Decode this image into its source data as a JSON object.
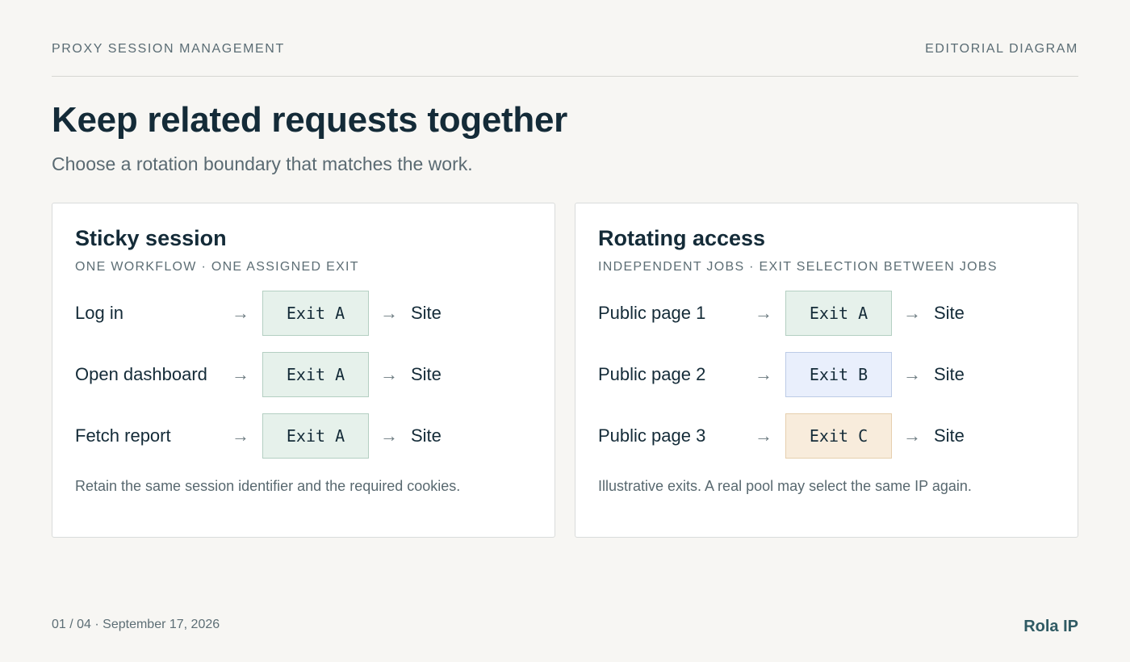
{
  "header": {
    "eyebrow": "PROXY SESSION MANAGEMENT",
    "tag": "EDITORIAL DIAGRAM"
  },
  "title": "Keep related requests together",
  "subtitle": "Choose a rotation boundary that matches the work.",
  "cards": [
    {
      "title": "Sticky session",
      "subtitle": "ONE WORKFLOW · ONE ASSIGNED EXIT",
      "rows": [
        {
          "step": "Log in",
          "exit": "Exit A",
          "target": "Site"
        },
        {
          "step": "Open dashboard",
          "exit": "Exit A",
          "target": "Site"
        },
        {
          "step": "Fetch report",
          "exit": "Exit A",
          "target": "Site"
        }
      ],
      "note": "Retain the same session identifier and the required cookies."
    },
    {
      "title": "Rotating access",
      "subtitle": "INDEPENDENT JOBS · EXIT SELECTION BETWEEN JOBS",
      "rows": [
        {
          "step": "Public page 1",
          "exit": "Exit A",
          "target": "Site"
        },
        {
          "step": "Public page 2",
          "exit": "Exit B",
          "target": "Site"
        },
        {
          "step": "Public page 3",
          "exit": "Exit C",
          "target": "Site"
        }
      ],
      "note": "Illustrative exits. A real pool may select the same IP again."
    }
  ],
  "arrow": "→",
  "colors": {
    "exit_a": "#e6f1eb",
    "exit_b": "#e9effc",
    "exit_c": "#f8ecdc"
  },
  "footer": {
    "page": "01 / 04 · September 17, 2026",
    "brand": "Rola IP"
  }
}
